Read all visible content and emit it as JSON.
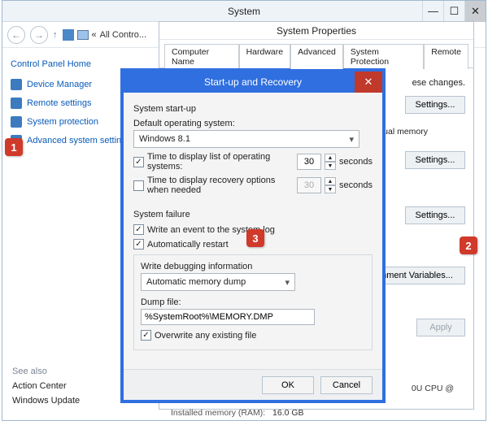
{
  "syswin": {
    "title": "System",
    "breadcrumb_prefix": "«",
    "breadcrumb_text": "All Contro..."
  },
  "leftpane": {
    "home": "Control Panel Home",
    "items": [
      "Device Manager",
      "Remote settings",
      "System protection",
      "Advanced system settin"
    ],
    "seealso_h": "See also",
    "seealso": [
      "Action Center",
      "Windows Update"
    ]
  },
  "callouts": {
    "c1": "1",
    "c2": "2",
    "c3": "3"
  },
  "propwin": {
    "title": "System Properties",
    "tabs": [
      "Computer Name",
      "Hardware",
      "Advanced",
      "System Protection",
      "Remote"
    ],
    "note": "ese changes.",
    "ual_memory": "ual memory",
    "settings": "Settings...",
    "envvars": "nment Variables...",
    "apply": "Apply",
    "proc": "0U CPU @",
    "ram_label": "Installed memory (RAM):",
    "ram_value": "16.0 GB"
  },
  "dlg": {
    "title": "Start-up and Recovery",
    "sec1": "System start-up",
    "default_os_label": "Default operating system:",
    "default_os": "Windows 8.1",
    "time_list": "Time to display list of operating systems:",
    "time_rec": "Time to display recovery options when needed",
    "val_list": "30",
    "val_rec": "30",
    "seconds": "seconds",
    "sec2": "System failure",
    "write_event": "Write an event to the system log",
    "auto_restart": "Automatically restart",
    "wdi": "Write debugging information",
    "dump_mode": "Automatic memory dump",
    "dump_label": "Dump file:",
    "dump_path": "%SystemRoot%\\MEMORY.DMP",
    "overwrite": "Overwrite any existing file",
    "ok": "OK",
    "cancel": "Cancel"
  }
}
